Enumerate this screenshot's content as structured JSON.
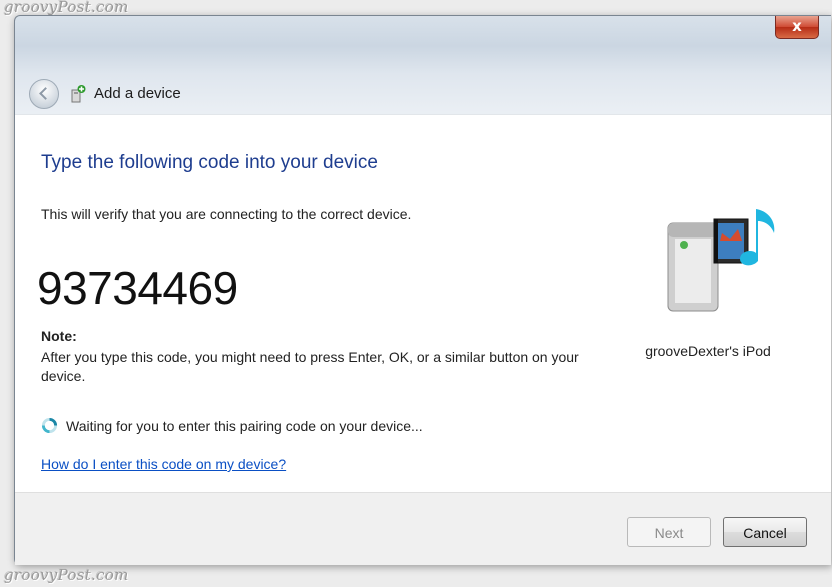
{
  "watermark": {
    "top": "groovyPost.com",
    "bottom": "groovyPost.com"
  },
  "window": {
    "title": "Add a device",
    "heading": "Type the following code into your device",
    "subtitle": "This will verify that you are connecting to the correct device.",
    "pairing_code": "93734469",
    "note_title": "Note:",
    "note_body": "After you type this code, you might need to press Enter, OK, or a similar button on your device.",
    "status_text": "Waiting for you to enter this pairing code on your device...",
    "help_link": "How do I enter this code on my device?",
    "device_name": "grooveDexter's iPod",
    "buttons": {
      "next": "Next",
      "cancel": "Cancel",
      "close": "x"
    }
  },
  "icons": {
    "back": "back-arrow-icon",
    "title": "add-device-icon",
    "status": "spinner-icon",
    "device": "media-device-icon"
  },
  "colors": {
    "heading": "#1e3d8f",
    "link": "#0a4fc4",
    "close_button": "#c63b23"
  }
}
